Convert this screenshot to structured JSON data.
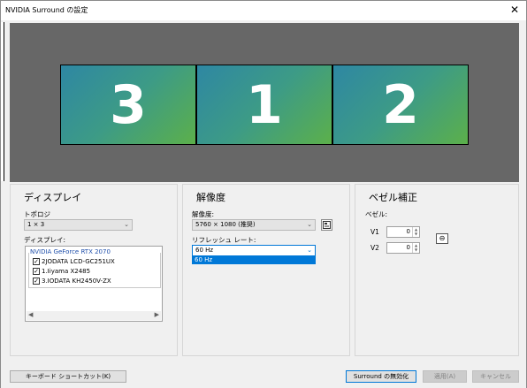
{
  "window": {
    "title": "NVIDIA Surround の設定",
    "close_glyph": "✕"
  },
  "preview": {
    "displays": [
      {
        "number": "3"
      },
      {
        "number": "1"
      },
      {
        "number": "2"
      }
    ]
  },
  "display_panel": {
    "title": "ディスプレイ",
    "topology_label": "トポロジ",
    "topology_value": "1 × 3",
    "displays_label": "ディスプレイ:",
    "gpu_group": "NVIDIA GeForce RTX 2070",
    "items": [
      {
        "label": "2JODATA LCD-GC251UX",
        "checked": true
      },
      {
        "label": "1.Iiyama X2485",
        "checked": true
      },
      {
        "label": "3.IODATA KH2450V-ZX",
        "checked": true
      }
    ]
  },
  "resolution_panel": {
    "title": "解像度",
    "resolution_label": "解像度:",
    "resolution_value": "5760 × 1080 (推奨)",
    "refresh_label": "リフレッシュ レート:",
    "refresh_value": "60 Hz",
    "refresh_options": [
      "60 Hz"
    ],
    "icon": "custom-resolution-icon"
  },
  "bezel_panel": {
    "title": "ベゼル補正",
    "bezel_label": "ベゼル:",
    "v1_label": "V1",
    "v1_value": "0",
    "v2_label": "V2",
    "v2_value": "0",
    "link_icon": "link-icon"
  },
  "footer": {
    "shortcut_button": "キーボード ショートカット(K)",
    "disable_button": "Surround の無効化",
    "apply_button": "適用(A)",
    "cancel_button": "キャンセル"
  },
  "colors": {
    "preview_bg": "#676767",
    "selection": "#0078d7",
    "monitor_gradient_start": "#2e87a3",
    "monitor_gradient_end": "#5cb04a"
  }
}
